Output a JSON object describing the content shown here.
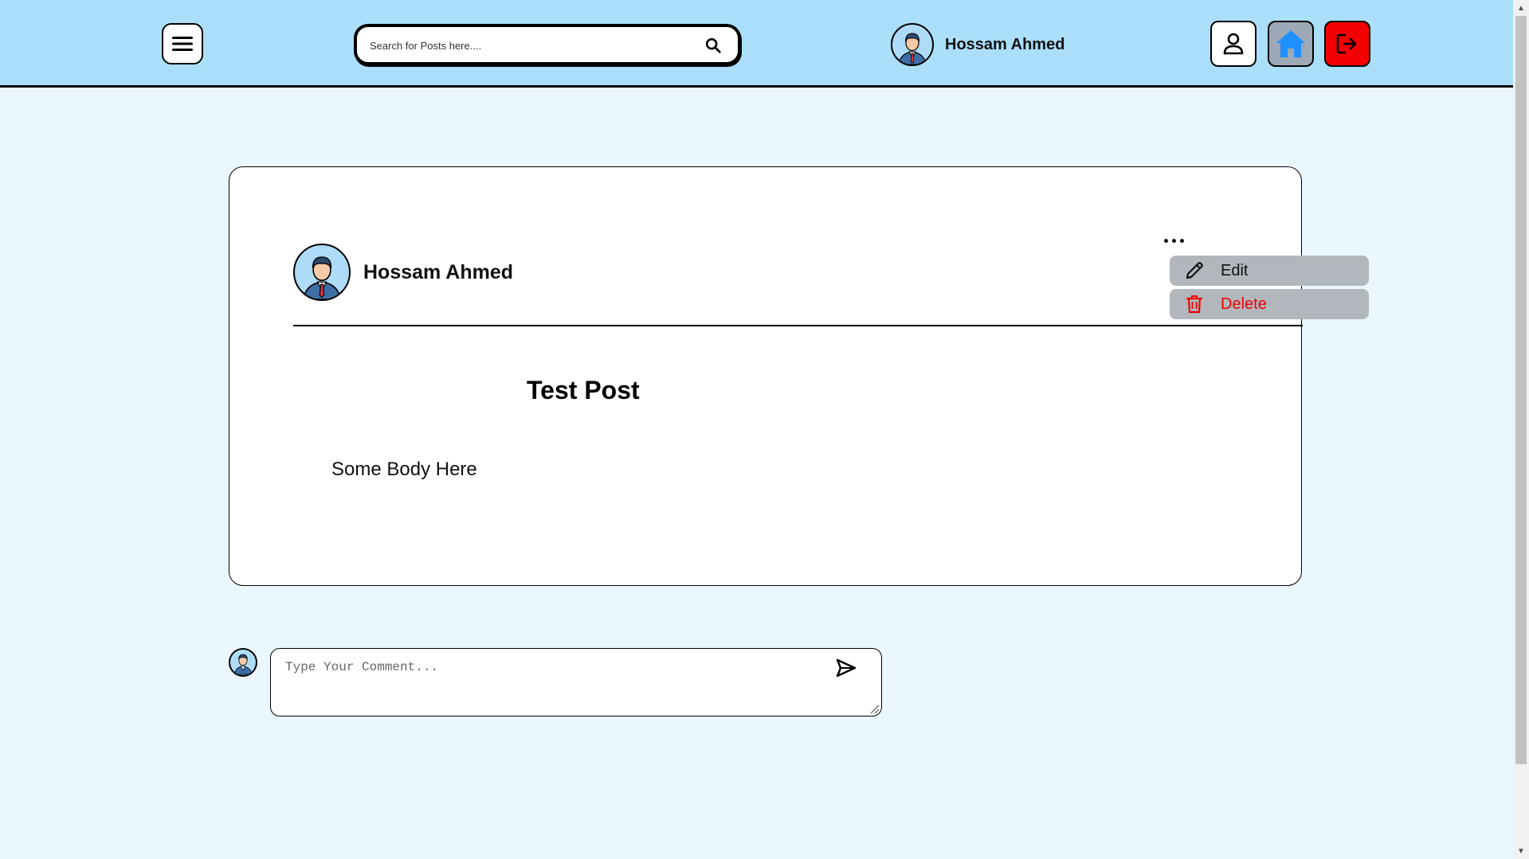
{
  "header": {
    "search": {
      "placeholder": "Search for Posts here....",
      "value": ""
    },
    "user": {
      "name": "Hossam Ahmed"
    },
    "buttons": {
      "menu_icon": "hamburger-icon",
      "profile_icon": "user-icon",
      "home_icon": "home-icon",
      "logout_icon": "logout-icon"
    }
  },
  "post": {
    "author": "Hossam Ahmed",
    "title": "Test Post",
    "body": "Some Body Here",
    "menu": {
      "items": [
        {
          "label": "Edit",
          "icon": "pencil-icon"
        },
        {
          "label": "Delete",
          "icon": "trash-icon"
        }
      ]
    }
  },
  "comment": {
    "placeholder": "Type Your Comment...",
    "value": ""
  },
  "colors": {
    "header_bg": "#abdff9",
    "page_bg": "#ebf7fe",
    "home_btn_bg": "#9da9b6",
    "home_icon": "#1e90ff",
    "logout_btn_bg": "#f50000",
    "delete_text": "#ee0000",
    "menu_item_bg": "#b1b7bc"
  }
}
